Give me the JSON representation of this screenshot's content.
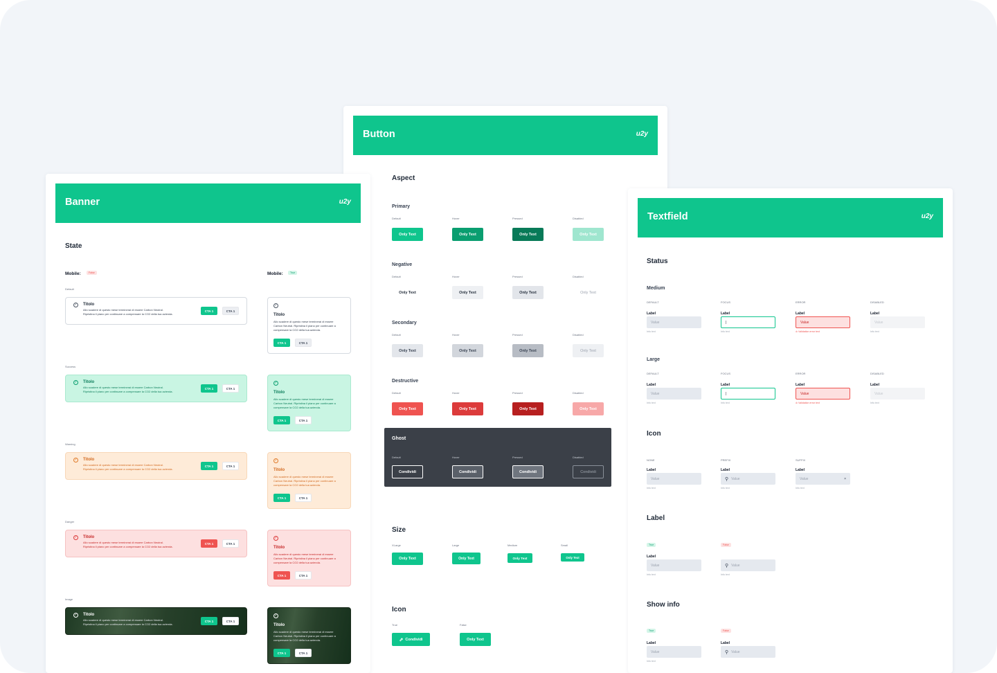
{
  "logo": "u2y",
  "button_card": {
    "title": "Button",
    "aspect": "Aspect",
    "states": [
      "Default",
      "Hover",
      "Pressed",
      "Disabled"
    ],
    "rows": {
      "primary": "Primary",
      "negative": "Negative",
      "secondary": "Secondary",
      "destructive": "Destructive",
      "ghost": "Ghost"
    },
    "only_text": "Only Text",
    "condividi": "Condividi",
    "size": "Size",
    "sizes": [
      "XLarge",
      "Large",
      "Medium",
      "Small"
    ],
    "icon": "Icon",
    "icon_true": "True",
    "icon_false": "False",
    "colors": {
      "primary": "#0fc58d",
      "hover": "#0a9e70",
      "pressed": "#087a58",
      "disabled": "#9fe6cf",
      "destructive": "#ef5350",
      "destr_hover": "#dc3b3b",
      "destr_pressed": "#b71f1f",
      "destr_disabled": "#f7a8a8",
      "ghost_bg": "#3b4048"
    }
  },
  "banner_card": {
    "title": "Banner",
    "state": "State",
    "mobile_false": "Mobile:",
    "false": "False",
    "mobile_true": "Mobile:",
    "true": "True",
    "variants": [
      "Default",
      "Success",
      "Warning",
      "Danger",
      "Image"
    ],
    "banner_title": "Titolo",
    "banner_text_1": "Allo scadere di questo mese terminerai di essere Carbon Neutral.",
    "banner_text_2": "Ripristina il piano per continuare a compensare la CO2 della tua azienda.",
    "mobile_text_1": "Allo scadere di questo mese terminerai di essere",
    "mobile_text_2": "Carbon Neutral. Ripristina il piano per continuare a",
    "mobile_text_3": "compensare la CO2 della tua azienda.",
    "cta": "CTA 1"
  },
  "textfield_card": {
    "title": "Textfield",
    "status": "Status",
    "medium": "Medium",
    "large": "Large",
    "states": [
      "Default",
      "Focus",
      "Error",
      "Disabled"
    ],
    "label": "Label",
    "value": "Value",
    "info": "Info text",
    "error_text": "Validation error text",
    "icon": "Icon",
    "icon_states": [
      "None",
      "Prefix",
      "Suffix"
    ],
    "label_section": "Label",
    "show_info": "Show info",
    "true": "True",
    "false": "False"
  }
}
